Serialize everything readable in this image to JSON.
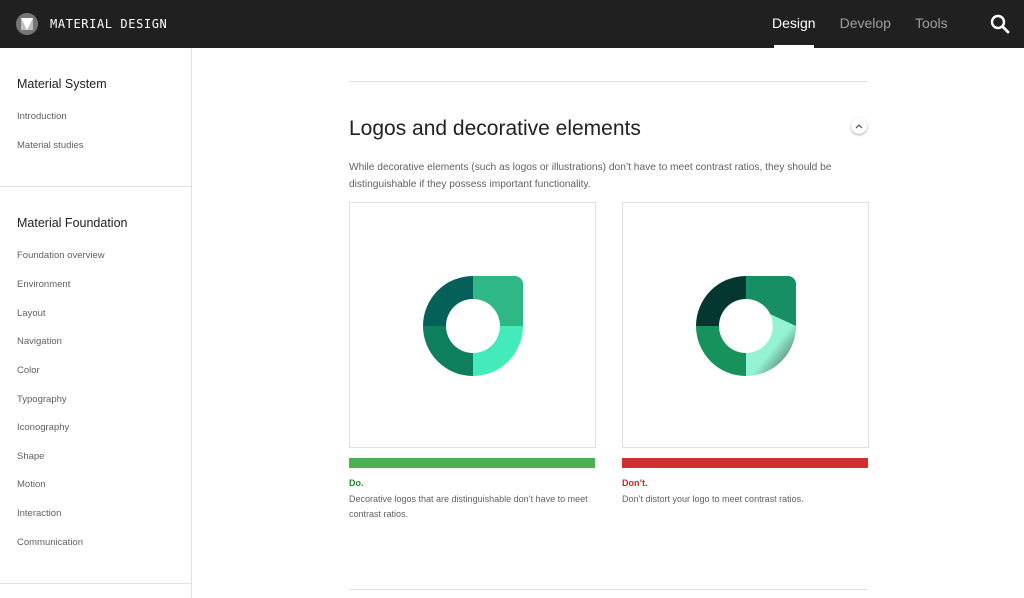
{
  "topbar": {
    "brand_title": "MATERIAL DESIGN",
    "tabs": [
      {
        "label": "Design",
        "active": true
      },
      {
        "label": "Develop",
        "active": false
      },
      {
        "label": "Tools",
        "active": false
      }
    ],
    "search_icon": "search-icon"
  },
  "sidebar": {
    "group1": {
      "heading": "Material System",
      "items": [
        "Introduction",
        "Material studies"
      ]
    },
    "group2": {
      "heading": "Material Foundation",
      "items": [
        "Foundation overview",
        "Environment",
        "Layout",
        "Navigation",
        "Color",
        "Typography",
        "Iconography",
        "Shape",
        "Motion",
        "Interaction",
        "Communication"
      ]
    }
  },
  "main": {
    "title": "Logos and decorative elements",
    "collapse_icon": "chevron-up-icon",
    "body": "While decorative elements (such as logos or illustrations) don’t have to meet contrast ratios, they should be distinguishable if they possess important functionality.",
    "do": {
      "label": "Do.",
      "caption": "Decorative logos that are distinguishable don’t have to meet contrast ratios.",
      "color": "#4caf50",
      "label_color": "#2e7d32"
    },
    "dont": {
      "label": "Don’t.",
      "caption": "Don’t distort your logo to meet contrast ratios.",
      "color": "#d32f2f",
      "label_color": "#c62828"
    }
  },
  "colors": {
    "topbar": "#202020",
    "logo_do": [
      "#05605a",
      "#2db886",
      "#0d7f5a",
      "#43ebbb"
    ],
    "logo_dont": [
      "#03372f",
      "#178f65",
      "#17925d",
      "#93f3d3"
    ]
  }
}
